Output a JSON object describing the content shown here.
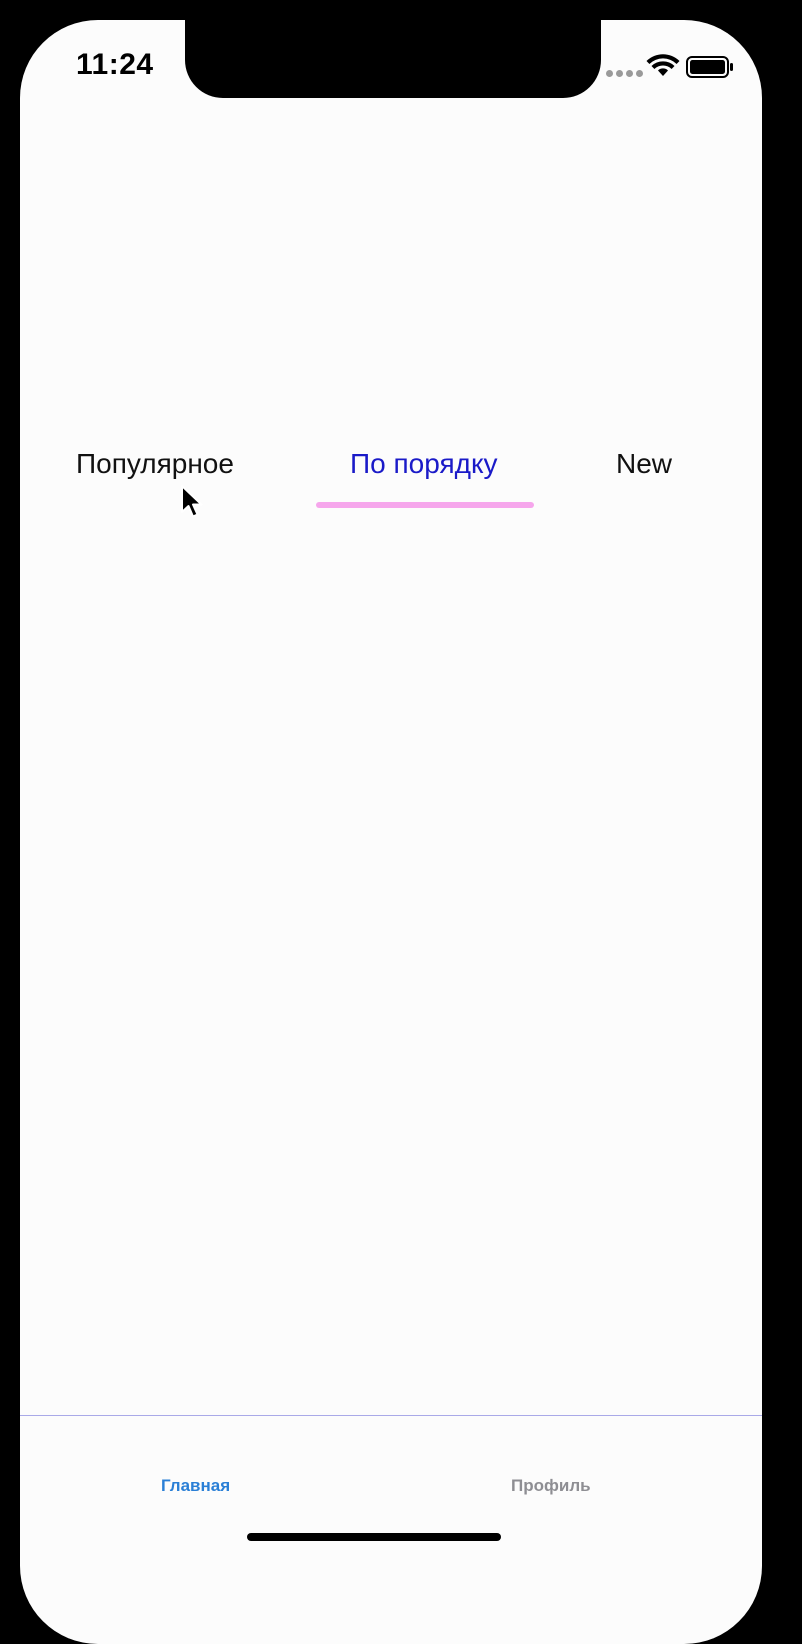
{
  "status_bar": {
    "time": "11:24"
  },
  "tabs": {
    "items": [
      {
        "label": "Популярное",
        "active": false
      },
      {
        "label": "По порядку",
        "active": true
      },
      {
        "label": "New",
        "active": false
      }
    ],
    "active_color": "#1a1ac8",
    "inactive_color": "#111111",
    "underline_color": "#f6a6ec"
  },
  "tab_bar": {
    "items": [
      {
        "label": "Главная",
        "active": true,
        "color": "#2a7fd6"
      },
      {
        "label": "Профиль",
        "active": false,
        "color": "#8e8e93"
      }
    ]
  },
  "icons": {
    "signal": "signal-dots-icon",
    "wifi": "wifi-icon",
    "battery": "battery-icon",
    "cursor": "mouse-cursor-icon"
  }
}
